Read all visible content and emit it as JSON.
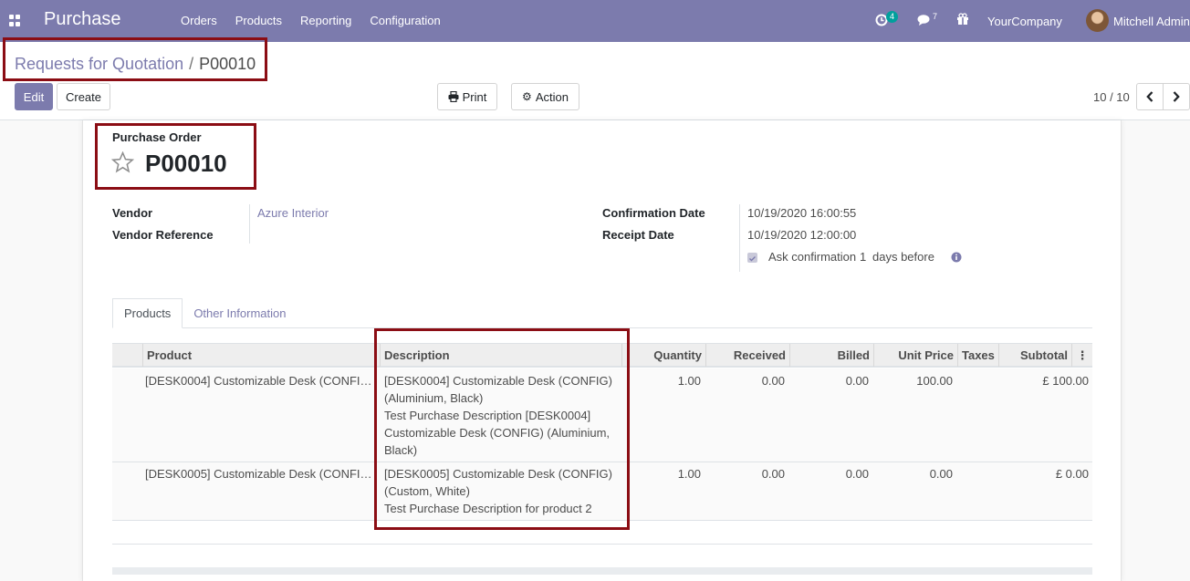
{
  "navbar": {
    "app_name": "Purchase",
    "menu": [
      "Orders",
      "Products",
      "Reporting",
      "Configuration"
    ],
    "activity_count": "4",
    "message_count": "7",
    "company": "YourCompany",
    "user": "Mitchell Admin"
  },
  "breadcrumb": {
    "parent": "Requests for Quotation",
    "separator": "/",
    "current": "P00010"
  },
  "toolbar": {
    "edit_label": "Edit",
    "create_label": "Create",
    "print_label": "Print",
    "action_label": "Action",
    "pager": "10 / 10"
  },
  "form": {
    "doc_type": "Purchase Order",
    "name": "P00010",
    "vendor_label": "Vendor",
    "vendor_value": "Azure Interior",
    "vendor_ref_label": "Vendor Reference",
    "confirmation_label": "Confirmation Date",
    "confirmation_value": "10/19/2020 16:00:55",
    "receipt_label": "Receipt Date",
    "receipt_value": "10/19/2020 12:00:00",
    "ask_text": "Ask confirmation",
    "ask_days": "1",
    "ask_suffix": "days before"
  },
  "tabs": [
    "Products",
    "Other Information"
  ],
  "table": {
    "columns": [
      "Product",
      "Description",
      "Quantity",
      "Received",
      "Billed",
      "Unit Price",
      "Taxes",
      "Subtotal"
    ],
    "rows": [
      {
        "product": "[DESK0004] Customizable Desk (CONFI…",
        "description": [
          "[DESK0004] Customizable Desk (CONFIG)",
          "(Aluminium, Black)",
          "Test Purchase Description [DESK0004]",
          "Customizable Desk (CONFIG) (Aluminium,",
          "Black)"
        ],
        "quantity": "1.00",
        "received": "0.00",
        "billed": "0.00",
        "unit_price": "100.00",
        "taxes": "",
        "subtotal": "£ 100.00"
      },
      {
        "product": "[DESK0005] Customizable Desk (CONFI…",
        "description": [
          "[DESK0005] Customizable Desk (CONFIG)",
          "(Custom, White)",
          "Test Purchase Description for product 2"
        ],
        "quantity": "1.00",
        "received": "0.00",
        "billed": "0.00",
        "unit_price": "0.00",
        "taxes": "",
        "subtotal": "£ 0.00"
      }
    ]
  },
  "colors": {
    "brand": "#7c7bad",
    "highlight": "#8b0d14"
  }
}
